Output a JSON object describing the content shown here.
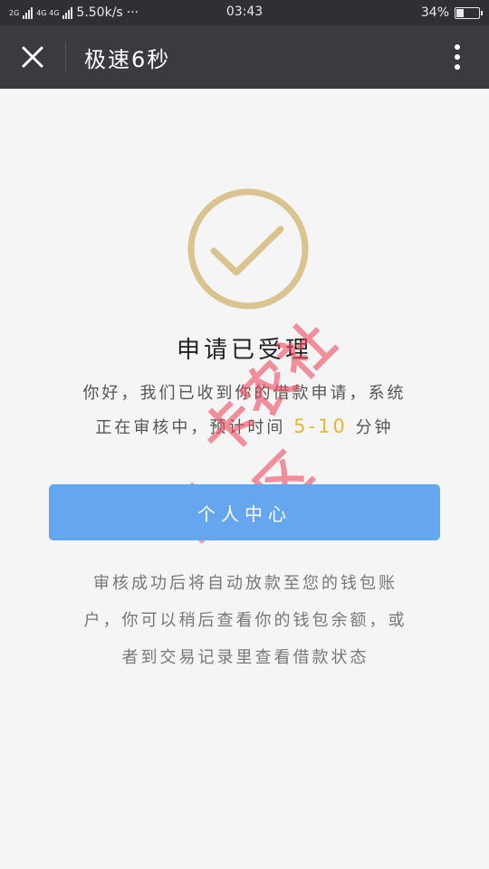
{
  "status_bar": {
    "network_2g": "2G",
    "network_4g": "4G 4G",
    "speed": "5.50k/s",
    "dots": "···",
    "time": "03:43",
    "battery_text": "34%",
    "battery_level": 0.34
  },
  "nav": {
    "title": "极速6秒",
    "close_icon": "close-icon",
    "more_icon": "more-vertical-icon"
  },
  "result": {
    "icon": "check-circle-icon",
    "icon_color": "#d9c38e",
    "title": "申请已受理",
    "desc_line1": "你好，我们已收到你的借款申请，系统",
    "desc_line2_a": "正在审核中，预计时间",
    "desc_highlight": "5-10",
    "desc_line2_b": "分钟"
  },
  "button": {
    "label": "个人中心",
    "color": "#64a6f0"
  },
  "note": {
    "line1": "审核成功后将自动放款至您的钱包账",
    "line2": "户，你可以稍后查看你的钱包余额，或",
    "line3": "者到交易记录里查看借款状态"
  },
  "watermark": {
    "text": "卡农社区",
    "color": "#f04a5e"
  }
}
